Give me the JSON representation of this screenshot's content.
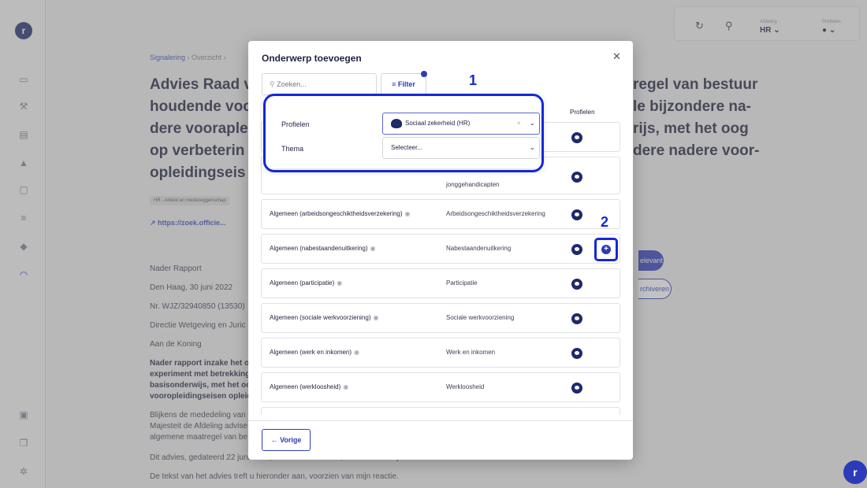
{
  "topbar": {
    "afdeling_label": "Afdeling",
    "afdeling_value": "HR",
    "profielen_label": "Profielen"
  },
  "background": {
    "breadcrumb_1": "Signalering",
    "breadcrumb_2": "Overzicht",
    "title_left": "Advies Raad v houdende voo dere vooraple op verbeterin opleidingseis",
    "title_right": "regel van bestuur le bijzondere na- rijs, met het oog dere nadere voor-",
    "tag": "HR - Arbeid en medezeggenschap",
    "link": "https://zoek.officie...",
    "relevant_button": "elevant",
    "archive_button": "rchiveren",
    "lines": [
      "Nader Rapport",
      "Den Haag, 30 juni 2022",
      "Nr. WJZ/32940850 (13530)",
      "Directie Wetgeving en Juric",
      "Aan de Koning",
      "Nader rapport inzake het or",
      "experiment met betrekking",
      "basisonderwijs, met het oo",
      "vooropleidingseisen opleid",
      "Blijkens de mededeling van",
      "Majesteit de Afdeling advise",
      "algemene maatregel van be",
      "Dit advies, gedateerd 22 juni 2022, nr. W05.22.00040/I, bied ik U hierbij aan.",
      "De tekst van het advies treft u hieronder aan, voorzien van mijn reactie."
    ]
  },
  "modal": {
    "title": "Onderwerp toevoegen",
    "search_placeholder": "Zoeken...",
    "filter_label": "Filter",
    "profielen_col": "Profielen",
    "filter_panel": {
      "profielen_label": "Profielen",
      "profielen_value": "Sociaal zekerheid (HR)",
      "thema_label": "Thema",
      "thema_placeholder": "Selecteer..."
    },
    "rows": [
      {
        "name": "",
        "theme": ""
      },
      {
        "name": "",
        "theme": "jonggehandicapten"
      },
      {
        "name": "Algemeen (arbeidsongeschiktheidsverzekering)",
        "theme": "Arbeidsongeschiktheidsverzekering"
      },
      {
        "name": "Algemeen (nabestaandenuitkering)",
        "theme": "Nabestaandenuitkering"
      },
      {
        "name": "Algemeen (participatie)",
        "theme": "Participatie"
      },
      {
        "name": "Algemeen (sociale werkvoorziening)",
        "theme": "Sociale werkvoorziening"
      },
      {
        "name": "Algemeen (werk en inkomen)",
        "theme": "Werk en inkomen"
      },
      {
        "name": "Algemeen (werkloosheid)",
        "theme": "Werkloosheid"
      }
    ],
    "prev_button": "Vorige"
  },
  "annotations": {
    "label_1": "1",
    "label_2": "2"
  },
  "colors": {
    "accent": "#2d3bb8",
    "navy": "#1f2a6b",
    "annotation": "#1428d6"
  }
}
